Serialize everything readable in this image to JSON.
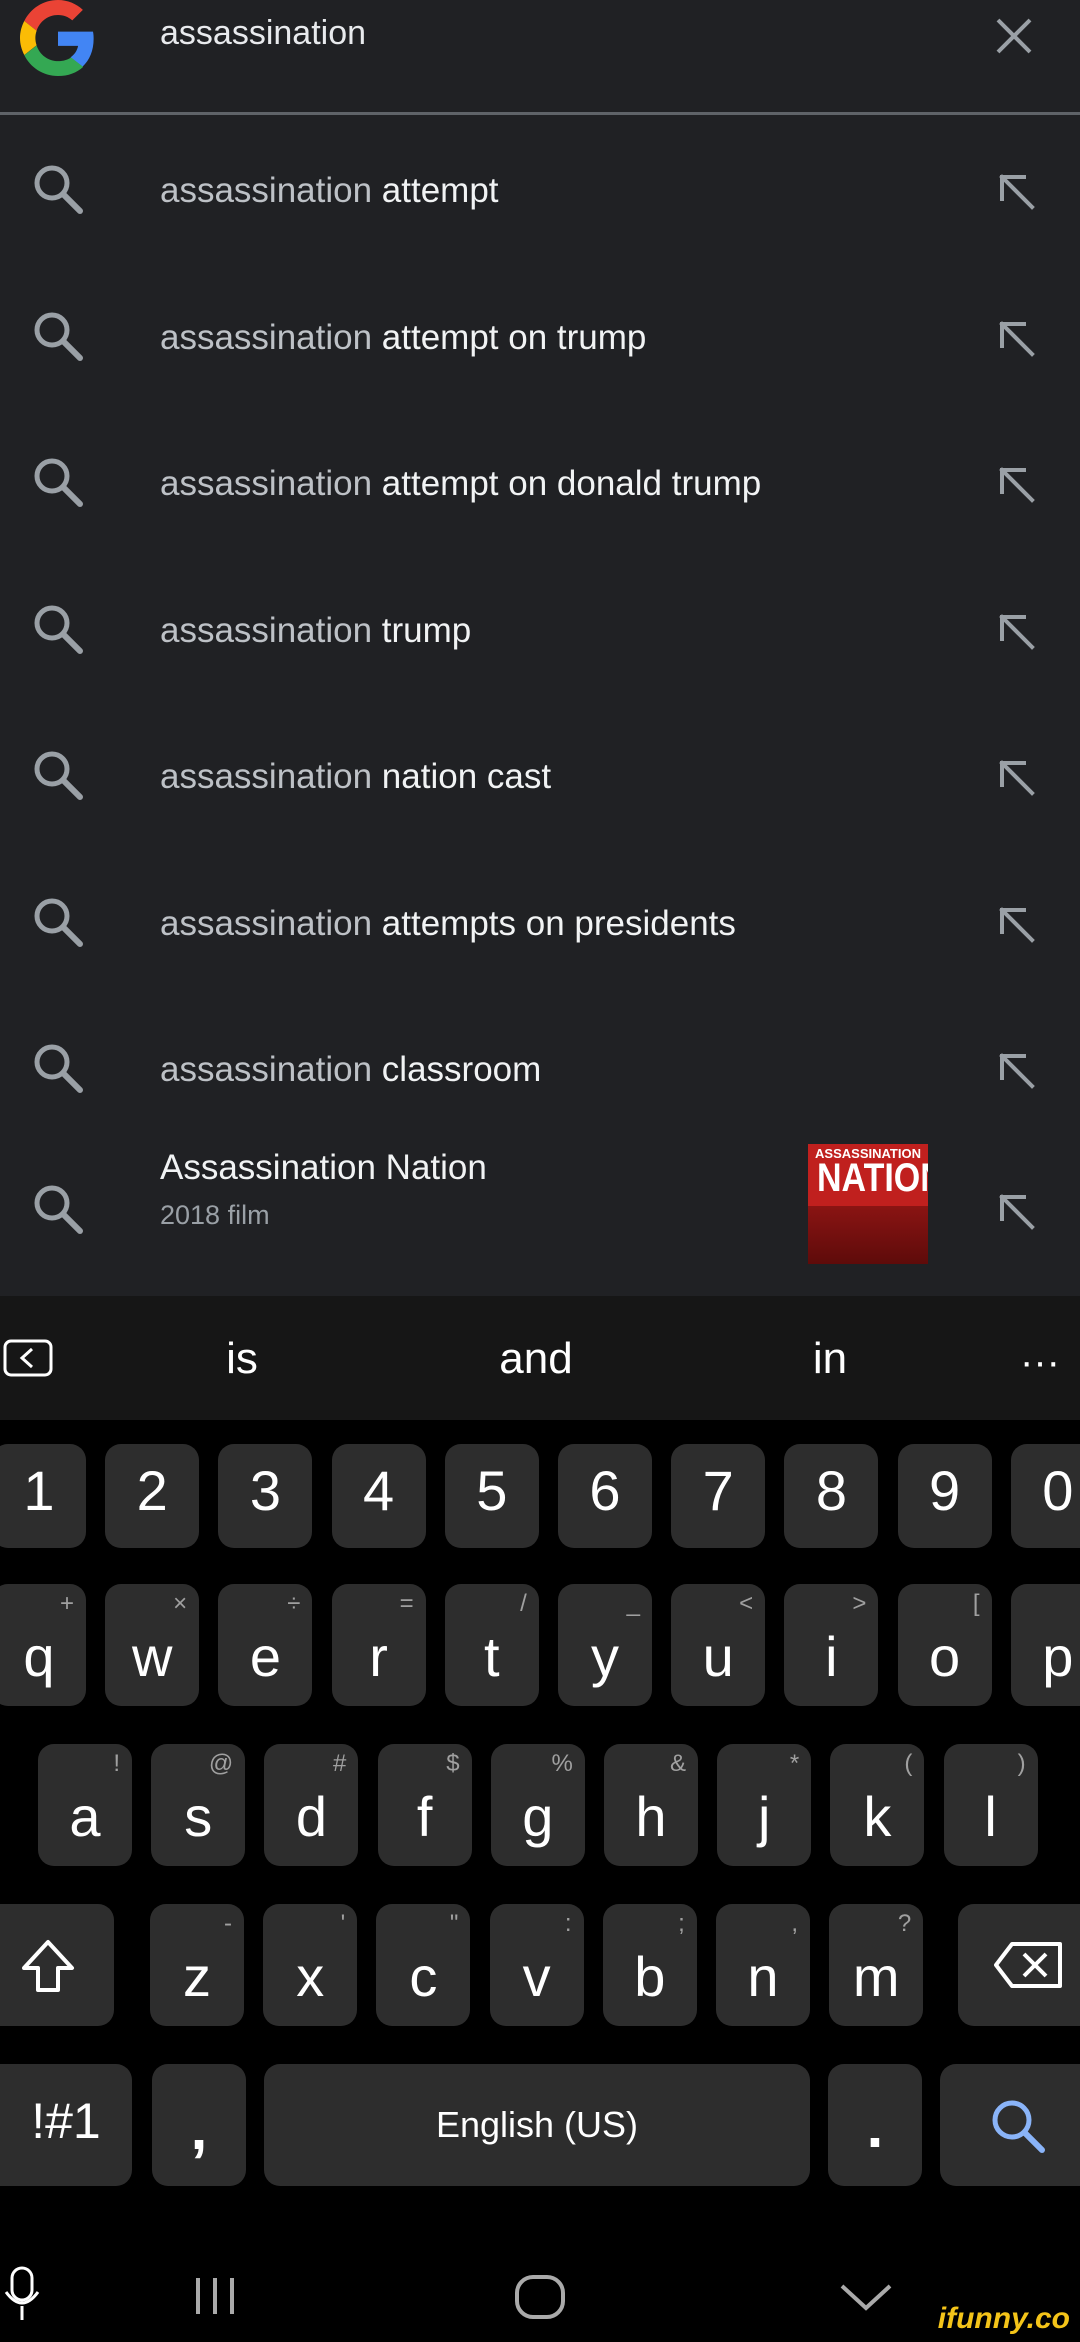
{
  "search": {
    "query": "assassination",
    "clear_icon": "close-icon"
  },
  "suggestions": [
    {
      "prefix": "assassination",
      "rest": " attempt"
    },
    {
      "prefix": "assassination",
      "rest": " attempt on trump"
    },
    {
      "prefix": "assassination",
      "rest": " attempt on donald trump"
    },
    {
      "prefix": "assassination",
      "rest": " trump"
    },
    {
      "prefix": "assassination",
      "rest": " nation cast"
    },
    {
      "prefix": "assassination",
      "rest": " attempts on presidents"
    },
    {
      "prefix": "assassination",
      "rest": " classroom"
    }
  ],
  "entity": {
    "title": "Assassination Nation",
    "subtitle": "2018 film",
    "poster_top": "ASSASSINATION",
    "poster_main": "NATION"
  },
  "predictions": [
    "is",
    "and",
    "in"
  ],
  "predictions_more": "···",
  "keys": {
    "numbers": [
      "1",
      "2",
      "3",
      "4",
      "5",
      "6",
      "7",
      "8",
      "9",
      "0"
    ],
    "row1": [
      {
        "k": "q",
        "h": "+"
      },
      {
        "k": "w",
        "h": "×"
      },
      {
        "k": "e",
        "h": "÷"
      },
      {
        "k": "r",
        "h": "="
      },
      {
        "k": "t",
        "h": "/"
      },
      {
        "k": "y",
        "h": "_"
      },
      {
        "k": "u",
        "h": "<"
      },
      {
        "k": "i",
        "h": ">"
      },
      {
        "k": "o",
        "h": "["
      },
      {
        "k": "p",
        "h": "]"
      }
    ],
    "row2": [
      {
        "k": "a",
        "h": "!"
      },
      {
        "k": "s",
        "h": "@"
      },
      {
        "k": "d",
        "h": "#"
      },
      {
        "k": "f",
        "h": "$"
      },
      {
        "k": "g",
        "h": "%"
      },
      {
        "k": "h",
        "h": "&"
      },
      {
        "k": "j",
        "h": "*"
      },
      {
        "k": "k",
        "h": "("
      },
      {
        "k": "l",
        "h": ")"
      }
    ],
    "row3": [
      {
        "k": "z",
        "h": "-"
      },
      {
        "k": "x",
        "h": "'"
      },
      {
        "k": "c",
        "h": "\""
      },
      {
        "k": "v",
        "h": ":"
      },
      {
        "k": "b",
        "h": ";"
      },
      {
        "k": "n",
        "h": ","
      },
      {
        "k": "m",
        "h": "?"
      }
    ],
    "symbols_label": "!#1",
    "comma_label": ",",
    "space_label": "English (US)",
    "period_label": "."
  },
  "watermark": "ifunny.co",
  "colors": {
    "background": "#202124",
    "keyboard_bg": "#000000",
    "key_bg": "#2d2d2d",
    "search_key_icon": "#8ab4f8"
  }
}
